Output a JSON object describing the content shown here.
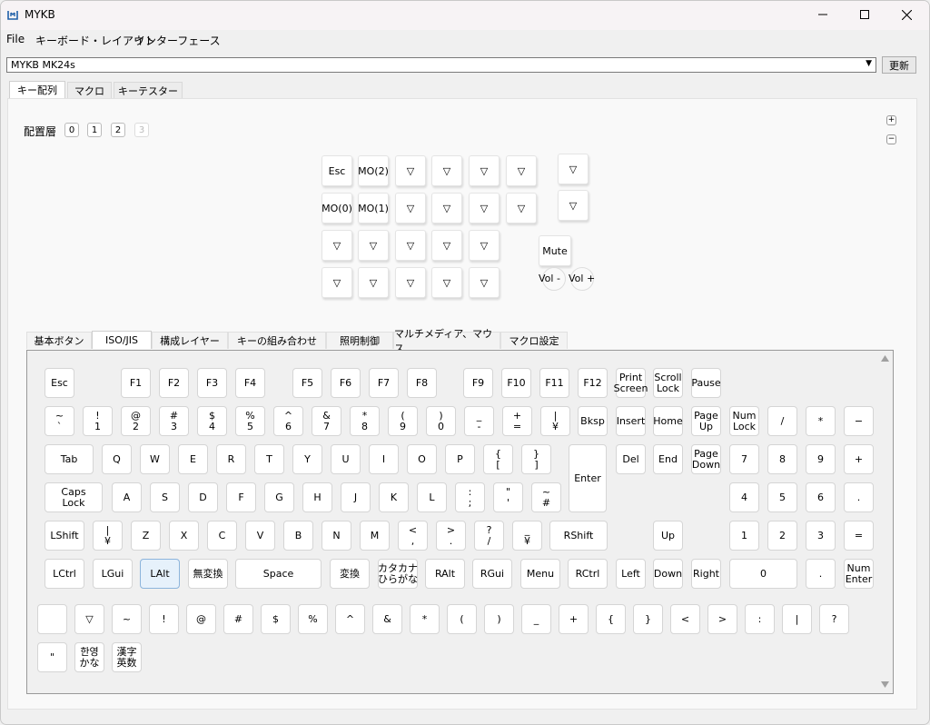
{
  "window": {
    "title": "MYKB"
  },
  "menu": [
    "File",
    "キーボード・レイアウト",
    "インターフェース"
  ],
  "device": {
    "selected": "MYKB MK24s",
    "refresh_label": "更新"
  },
  "top_tabs": [
    "キー配列",
    "マクロ",
    "キーテスター"
  ],
  "layers": {
    "label": "配置層",
    "items": [
      "0",
      "1",
      "2",
      "3"
    ],
    "plus": "+",
    "minus": "−"
  },
  "macropad": {
    "rows": [
      [
        "Esc",
        "MO(2)",
        "▽",
        "▽",
        "▽",
        "▽"
      ],
      [
        "MO(0)",
        "MO(1)",
        "▽",
        "▽",
        "▽",
        "▽"
      ],
      [
        "▽",
        "▽",
        "▽",
        "▽",
        "▽"
      ],
      [
        "▽",
        "▽",
        "▽",
        "▽",
        "▽"
      ]
    ],
    "side_keys": [
      "▽",
      "▽"
    ],
    "mute_label": "Mute",
    "vol_down": "Vol -",
    "vol_up": "Vol +"
  },
  "bottom_tabs": [
    "基本ボタン",
    "ISO/JIS",
    "構成レイヤー",
    "キーの組み合わせ",
    "照明制御",
    "マルチメディア、マウス",
    "マクロ設定"
  ],
  "keyboard": {
    "keys": [
      {
        "id": "esc",
        "t": "Esc"
      },
      {
        "id": "f1",
        "t": "F1"
      },
      {
        "id": "f2",
        "t": "F2"
      },
      {
        "id": "f3",
        "t": "F3"
      },
      {
        "id": "f4",
        "t": "F4"
      },
      {
        "id": "f5",
        "t": "F5"
      },
      {
        "id": "f6",
        "t": "F6"
      },
      {
        "id": "f7",
        "t": "F7"
      },
      {
        "id": "f8",
        "t": "F8"
      },
      {
        "id": "f9",
        "t": "F9"
      },
      {
        "id": "f10",
        "t": "F10"
      },
      {
        "id": "f11",
        "t": "F11"
      },
      {
        "id": "f12",
        "t": "F12"
      },
      {
        "id": "printscreen",
        "t": "Print",
        "b": "Screen"
      },
      {
        "id": "scrolllock",
        "t": "Scroll",
        "b": "Lock"
      },
      {
        "id": "pause",
        "t": "Pause"
      },
      {
        "id": "grave",
        "t": "~",
        "b": "`"
      },
      {
        "id": "1",
        "t": "!",
        "b": "1"
      },
      {
        "id": "2",
        "t": "@",
        "b": "2"
      },
      {
        "id": "3",
        "t": "#",
        "b": "3"
      },
      {
        "id": "4",
        "t": "$",
        "b": "4"
      },
      {
        "id": "5",
        "t": "%",
        "b": "5"
      },
      {
        "id": "6",
        "t": "^",
        "b": "6"
      },
      {
        "id": "7",
        "t": "&",
        "b": "7"
      },
      {
        "id": "8",
        "t": "*",
        "b": "8"
      },
      {
        "id": "9",
        "t": "(",
        "b": "9"
      },
      {
        "id": "0",
        "t": ")",
        "b": "0"
      },
      {
        "id": "minus",
        "t": "_",
        "b": "-"
      },
      {
        "id": "equal",
        "t": "+",
        "b": "="
      },
      {
        "id": "yen",
        "t": "|",
        "b": "¥"
      },
      {
        "id": "bksp",
        "t": "Bksp"
      },
      {
        "id": "insert",
        "t": "Insert"
      },
      {
        "id": "home",
        "t": "Home"
      },
      {
        "id": "pageup",
        "t": "Page",
        "b": "Up"
      },
      {
        "id": "numlock",
        "t": "Num",
        "b": "Lock"
      },
      {
        "id": "kpslash",
        "t": "/"
      },
      {
        "id": "kpstar",
        "t": "*"
      },
      {
        "id": "kpminus",
        "t": "−"
      },
      {
        "id": "tab",
        "t": "Tab"
      },
      {
        "id": "q",
        "t": "Q"
      },
      {
        "id": "w",
        "t": "W"
      },
      {
        "id": "e",
        "t": "E"
      },
      {
        "id": "r",
        "t": "R"
      },
      {
        "id": "t",
        "t": "T"
      },
      {
        "id": "y",
        "t": "Y"
      },
      {
        "id": "u",
        "t": "U"
      },
      {
        "id": "i",
        "t": "I"
      },
      {
        "id": "o",
        "t": "O"
      },
      {
        "id": "p",
        "t": "P"
      },
      {
        "id": "lbracket",
        "t": "{",
        "b": "["
      },
      {
        "id": "rbracket",
        "t": "}",
        "b": "]"
      },
      {
        "id": "enter",
        "t": "Enter"
      },
      {
        "id": "del",
        "t": "Del"
      },
      {
        "id": "end",
        "t": "End"
      },
      {
        "id": "pagedown",
        "t": "Page",
        "b": "Down"
      },
      {
        "id": "kp7",
        "t": "7"
      },
      {
        "id": "kp8",
        "t": "8"
      },
      {
        "id": "kp9",
        "t": "9"
      },
      {
        "id": "kpplus",
        "t": "+"
      },
      {
        "id": "caps",
        "t": "Caps",
        "b": "Lock"
      },
      {
        "id": "a",
        "t": "A"
      },
      {
        "id": "s",
        "t": "S"
      },
      {
        "id": "d",
        "t": "D"
      },
      {
        "id": "f",
        "t": "F"
      },
      {
        "id": "g",
        "t": "G"
      },
      {
        "id": "h",
        "t": "H"
      },
      {
        "id": "j",
        "t": "J"
      },
      {
        "id": "k",
        "t": "K"
      },
      {
        "id": "l",
        "t": "L"
      },
      {
        "id": "semicolon",
        "t": ":",
        "b": ";"
      },
      {
        "id": "quote",
        "t": "\"",
        "b": "'"
      },
      {
        "id": "hash",
        "t": "~",
        "b": "#"
      },
      {
        "id": "kp4",
        "t": "4"
      },
      {
        "id": "kp5",
        "t": "5"
      },
      {
        "id": "kp6",
        "t": "6"
      },
      {
        "id": "kpdot",
        "t": "."
      },
      {
        "id": "lshift",
        "t": "LShift"
      },
      {
        "id": "iso_bslash",
        "t": "|",
        "b": "¥"
      },
      {
        "id": "z",
        "t": "Z"
      },
      {
        "id": "x",
        "t": "X"
      },
      {
        "id": "c",
        "t": "C"
      },
      {
        "id": "v",
        "t": "V"
      },
      {
        "id": "b",
        "t": "B"
      },
      {
        "id": "n",
        "t": "N"
      },
      {
        "id": "m",
        "t": "M"
      },
      {
        "id": "comma",
        "t": "<",
        "b": ","
      },
      {
        "id": "period",
        "t": ">",
        "b": "."
      },
      {
        "id": "slash",
        "t": "?",
        "b": "/"
      },
      {
        "id": "ro",
        "t": "_",
        "b": "¥"
      },
      {
        "id": "rshift",
        "t": "RShift"
      },
      {
        "id": "up",
        "t": "Up"
      },
      {
        "id": "kp1",
        "t": "1"
      },
      {
        "id": "kp2",
        "t": "2"
      },
      {
        "id": "kp3",
        "t": "3"
      },
      {
        "id": "kpequal",
        "t": "="
      },
      {
        "id": "lctrl",
        "t": "LCtrl"
      },
      {
        "id": "lgui",
        "t": "LGui"
      },
      {
        "id": "lalt",
        "t": "LAlt"
      },
      {
        "id": "muhenkan",
        "t": "無変換"
      },
      {
        "id": "space",
        "t": "Space"
      },
      {
        "id": "henkan",
        "t": "変換"
      },
      {
        "id": "kana",
        "t": "カタカナ",
        "b": "ひらがな"
      },
      {
        "id": "ralt",
        "t": "RAlt"
      },
      {
        "id": "rgui",
        "t": "RGui"
      },
      {
        "id": "menu",
        "t": "Menu"
      },
      {
        "id": "rctrl",
        "t": "RCtrl"
      },
      {
        "id": "left",
        "t": "Left"
      },
      {
        "id": "down",
        "t": "Down"
      },
      {
        "id": "right",
        "t": "Right"
      },
      {
        "id": "kp0",
        "t": "0"
      },
      {
        "id": "kpdot2",
        "t": "."
      },
      {
        "id": "kpenter",
        "t": "Num",
        "b": "Enter"
      },
      {
        "id": "blank",
        "t": ""
      },
      {
        "id": "trans",
        "t": "▽"
      },
      {
        "id": "s_tilde",
        "t": "~"
      },
      {
        "id": "s_excl",
        "t": "!"
      },
      {
        "id": "s_at",
        "t": "@"
      },
      {
        "id": "s_hash",
        "t": "#"
      },
      {
        "id": "s_dollar",
        "t": "$"
      },
      {
        "id": "s_pct",
        "t": "%"
      },
      {
        "id": "s_caret",
        "t": "^"
      },
      {
        "id": "s_amp",
        "t": "&"
      },
      {
        "id": "s_star",
        "t": "*"
      },
      {
        "id": "s_lpar",
        "t": "("
      },
      {
        "id": "s_rpar",
        "t": ")"
      },
      {
        "id": "s_under",
        "t": "_"
      },
      {
        "id": "s_plus",
        "t": "+"
      },
      {
        "id": "s_lbrace",
        "t": "{"
      },
      {
        "id": "s_rbrace",
        "t": "}"
      },
      {
        "id": "s_lt",
        "t": "<"
      },
      {
        "id": "s_gt",
        "t": ">"
      },
      {
        "id": "s_colon",
        "t": ":"
      },
      {
        "id": "s_pipe",
        "t": "|"
      },
      {
        "id": "s_quest",
        "t": "?"
      },
      {
        "id": "s_dquote",
        "t": "\""
      },
      {
        "id": "hanyeong",
        "t": "한영",
        "b": "かな"
      },
      {
        "id": "hanja",
        "t": "漢字",
        "b": "英数"
      }
    ]
  },
  "colors": {
    "accent": "#e6f1fb",
    "window_bg": "#f0f0f0"
  }
}
